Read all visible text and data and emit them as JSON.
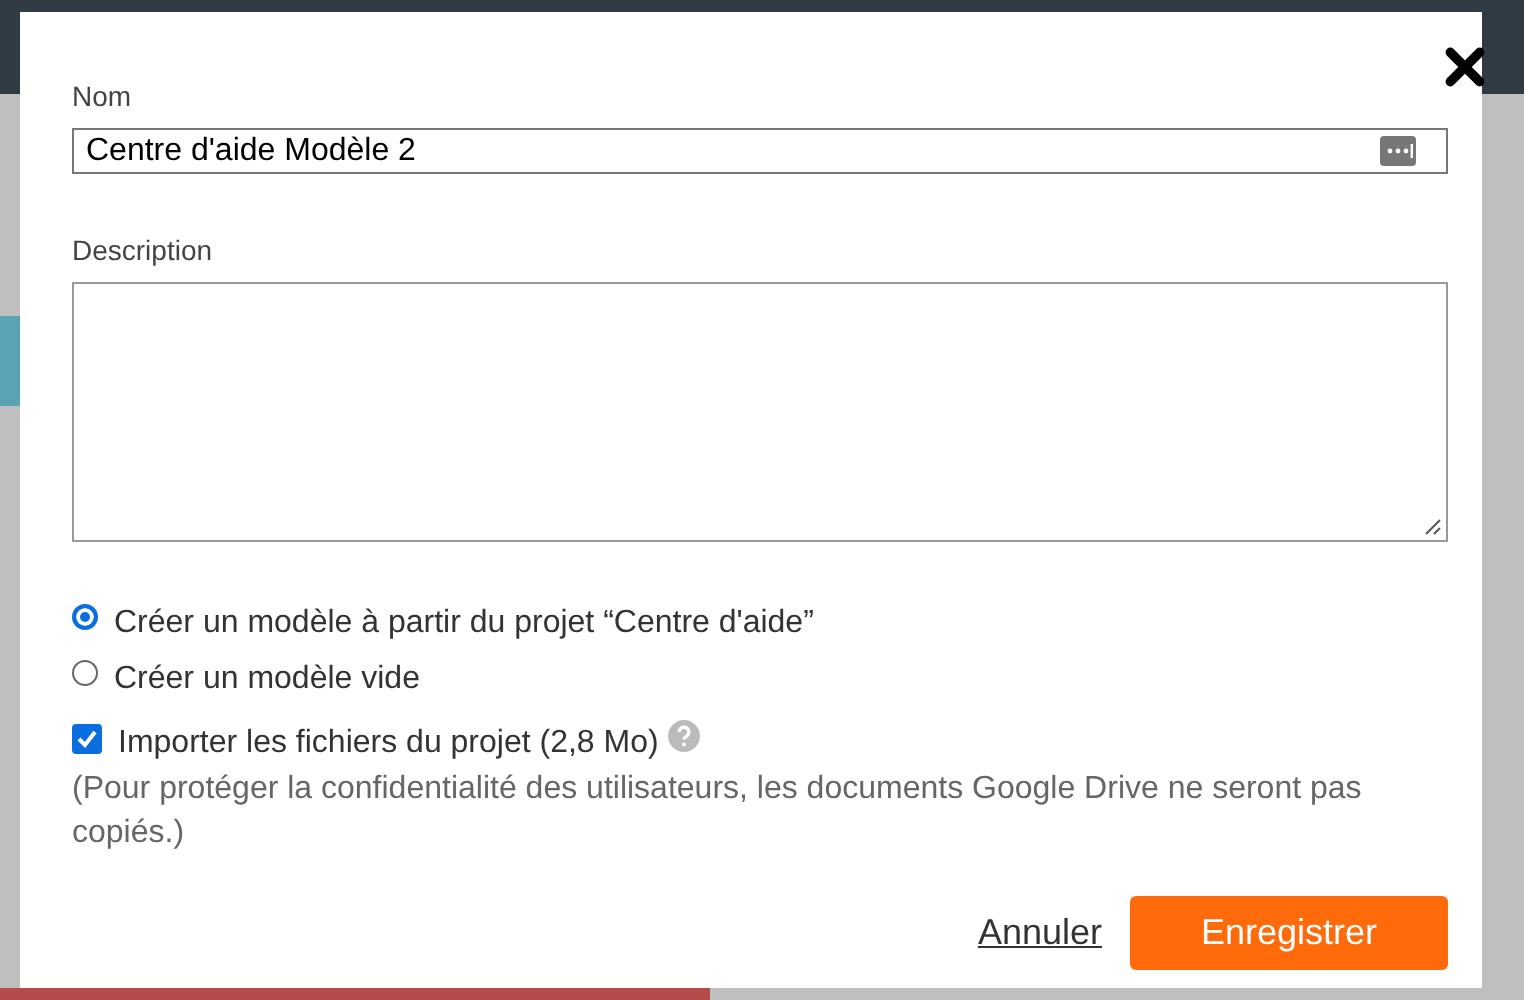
{
  "dialog": {
    "fields": [
      {
        "kind": "input",
        "label": "Nom",
        "value": "Centre d'aide Modèle 2"
      },
      {
        "kind": "textarea",
        "label": "Description"
      }
    ],
    "options": [
      {
        "label": "Créer un modèle à partir du projet “Centre d'aide”",
        "selected": true
      },
      {
        "label": "Créer un modèle vide",
        "selected": false
      }
    ],
    "import": {
      "label": "Importer les fichiers du projet (2,8 Mo)",
      "checked": true,
      "note": "(Pour protéger la confidentialité des utilisateurs, les documents Google Drive ne seront pas copiés.)"
    },
    "buttons": [
      {
        "kind": "link",
        "label": "Annuler"
      },
      {
        "kind": "primary",
        "label": "Enregistrer"
      }
    ]
  }
}
